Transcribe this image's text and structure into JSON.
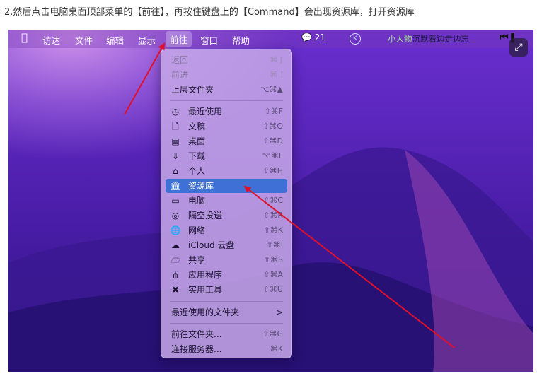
{
  "caption": "2.然后点击电脑桌面顶部菜单的【前往】，再按住键盘上的【Command】会出现资源库，打开资源库",
  "menubar": {
    "apple_icon": "apple-logo-icon",
    "items": [
      "访达",
      "文件",
      "编辑",
      "显示",
      "前往",
      "窗口",
      "帮助"
    ],
    "active_item": "前往",
    "wechat_count": "21",
    "k_label": "K",
    "ticker_prefix": "小人物",
    "ticker_rest": "沉默着边走边忘",
    "media_icon": "media-previous-pause-icon"
  },
  "expand_icon": "expand-icon",
  "go_menu": {
    "back": {
      "label": "返回",
      "shortcut": "⌘ ["
    },
    "forward": {
      "label": "前进",
      "shortcut": "⌘ ]"
    },
    "enclosing": {
      "label": "上层文件夹",
      "shortcut": "⌥⌘▲"
    },
    "recents": {
      "icon": "clock-icon",
      "label": "最近使用",
      "shortcut": "⇧⌘F"
    },
    "documents": {
      "icon": "document-icon",
      "label": "文稿",
      "shortcut": "⇧⌘O"
    },
    "desktop": {
      "icon": "desktop-icon",
      "label": "桌面",
      "shortcut": "⇧⌘D"
    },
    "downloads": {
      "icon": "download-icon",
      "label": "下载",
      "shortcut": "⌥⌘L"
    },
    "home": {
      "icon": "home-icon",
      "label": "个人",
      "shortcut": "⇧⌘H"
    },
    "library": {
      "icon": "library-icon",
      "label": "资源库",
      "shortcut": ""
    },
    "computer": {
      "icon": "laptop-icon",
      "label": "电脑",
      "shortcut": "⇧⌘C"
    },
    "airdrop": {
      "icon": "airdrop-icon",
      "label": "隔空投送",
      "shortcut": "⇧⌘R"
    },
    "network": {
      "icon": "globe-icon",
      "label": "网络",
      "shortcut": "⇧⌘K"
    },
    "icloud": {
      "icon": "cloud-icon",
      "label": "iCloud 云盘",
      "shortcut": "⇧⌘I"
    },
    "shared": {
      "icon": "shared-folder-icon",
      "label": "共享",
      "shortcut": "⇧⌘S"
    },
    "applications": {
      "icon": "applications-icon",
      "label": "应用程序",
      "shortcut": "⇧⌘A"
    },
    "utilities": {
      "icon": "tools-icon",
      "label": "实用工具",
      "shortcut": "⇧⌘U"
    },
    "recent_folders": {
      "label": "最近使用的文件夹",
      "chevron": ">"
    },
    "go_to_folder": {
      "label": "前往文件夹...",
      "shortcut": "⇧⌘G"
    },
    "connect_server": {
      "label": "连接服务器...",
      "shortcut": "⌘K"
    }
  },
  "colors": {
    "selection": "#3f70d6",
    "arrow": "#e0102a",
    "wallpaper_top": "#6b2fd0",
    "wallpaper_bottom": "#2b1382"
  }
}
